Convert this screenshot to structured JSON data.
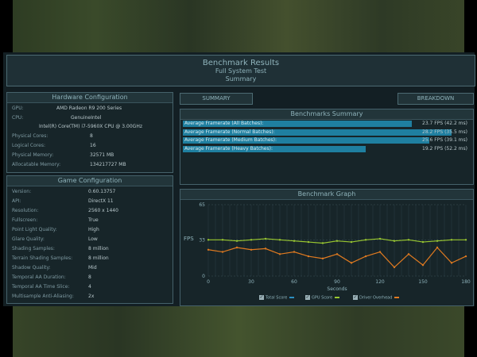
{
  "window": {
    "title": "Benchmark Results",
    "subtitle": "Full System Test",
    "subtitle2": "Summary"
  },
  "hardware": {
    "heading": "Hardware Configuration",
    "gpu_label": "GPU:",
    "gpu_value": "AMD Radeon R9 200 Series",
    "cpu_label": "CPU:",
    "cpu_value": "GenuineIntel",
    "cpu_model": "Intel(R) Core(TM) i7-5960X CPU @ 3.00GHz",
    "physical_cores_label": "Physical Cores:",
    "physical_cores_value": "8",
    "logical_cores_label": "Logical Cores:",
    "logical_cores_value": "16",
    "physical_memory_label": "Physical Memory:",
    "physical_memory_value": "32571 MB",
    "allocatable_memory_label": "Allocatable Memory:",
    "allocatable_memory_value": "134217727 MB"
  },
  "game": {
    "heading": "Game Configuration",
    "items": [
      {
        "label": "Version:",
        "value": "0.60.13757"
      },
      {
        "label": "API:",
        "value": "DirectX 11"
      },
      {
        "label": "Resolution:",
        "value": "2560 x 1440"
      },
      {
        "label": "Fullscreen:",
        "value": "True"
      },
      {
        "label": "Point Light Quality:",
        "value": "High"
      },
      {
        "label": "Glare Quality:",
        "value": "Low"
      },
      {
        "label": "Shading Samples:",
        "value": "8 million"
      },
      {
        "label": "Terrain Shading Samples:",
        "value": "8 million"
      },
      {
        "label": "Shadow Quality:",
        "value": "Mid"
      },
      {
        "label": "Temporal AA Duration:",
        "value": "8"
      },
      {
        "label": "Temporal AA Time Slice:",
        "value": "4"
      },
      {
        "label": "Multisample Anti-Aliasing:",
        "value": "2x"
      }
    ]
  },
  "tabs": {
    "summary": "SUMMARY",
    "breakdown": "BREAKDOWN"
  },
  "summary": {
    "heading": "Benchmarks Summary",
    "bars": [
      {
        "label": "Average Framerate (All Batches):",
        "value": "23.7 FPS (42.2 ms)",
        "fill": 0.8
      },
      {
        "label": "Average Framerate (Normal Batches):",
        "value": "28.2 FPS (35.5 ms)",
        "fill": 0.94
      },
      {
        "label": "Average Framerate (Medium Batches):",
        "value": "25.6 FPS (39.1 ms)",
        "fill": 0.86
      },
      {
        "label": "Average Framerate (Heavy Batches):",
        "value": "19.2 FPS (52.2 ms)",
        "fill": 0.64
      }
    ]
  },
  "graph": {
    "heading": "Benchmark Graph",
    "ylabel": "FPS",
    "xlabel": "Seconds",
    "legend": [
      {
        "label": "Total Score",
        "color": "#2c8fc0"
      },
      {
        "label": "GPU Score",
        "color": "#9ac830"
      },
      {
        "label": "Driver Overhead",
        "color": "#e07a20"
      }
    ]
  },
  "chart_data": {
    "type": "scatter",
    "title": "Benchmark Graph",
    "xlabel": "Seconds",
    "ylabel": "FPS",
    "xlim": [
      0,
      180
    ],
    "ylim": [
      0,
      65
    ],
    "x_ticks": [
      0,
      30,
      60,
      90,
      120,
      150,
      180
    ],
    "y_ticks": [
      0,
      33,
      65
    ],
    "grid": true,
    "legend_position": "bottom",
    "series": [
      {
        "name": "GPU Score",
        "x": [
          0,
          10,
          20,
          30,
          40,
          50,
          60,
          70,
          80,
          90,
          100,
          110,
          120,
          130,
          140,
          150,
          160,
          170,
          180
        ],
        "y": [
          33,
          33,
          32,
          33,
          34,
          33,
          32,
          31,
          30,
          32,
          31,
          33,
          34,
          32,
          33,
          31,
          32,
          33,
          33
        ]
      },
      {
        "name": "Driver Overhead",
        "x": [
          0,
          10,
          20,
          30,
          40,
          50,
          60,
          70,
          80,
          90,
          100,
          110,
          120,
          130,
          140,
          150,
          160,
          170,
          180
        ],
        "y": [
          24,
          22,
          26,
          24,
          25,
          20,
          22,
          18,
          16,
          20,
          12,
          18,
          22,
          8,
          20,
          10,
          26,
          12,
          18
        ]
      }
    ]
  }
}
